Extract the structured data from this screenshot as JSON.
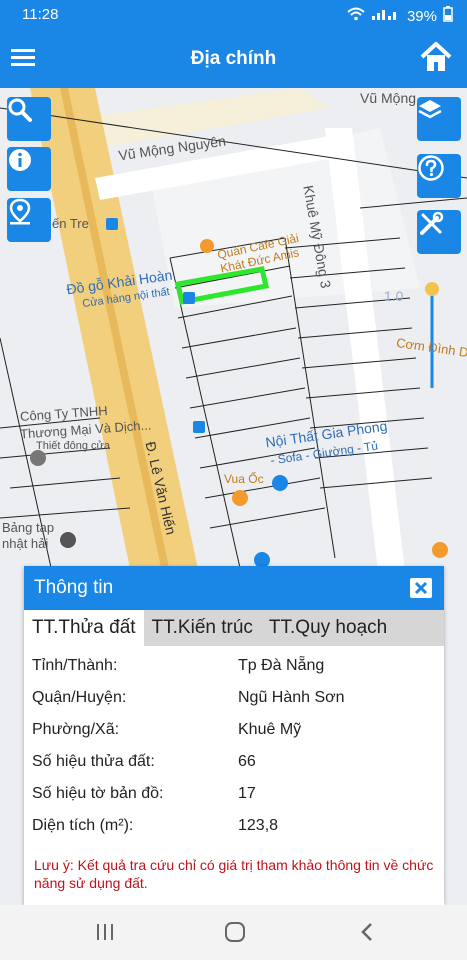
{
  "status_bar": {
    "time": "11:28",
    "battery": "39%"
  },
  "header": {
    "title": "Địa chính"
  },
  "map": {
    "labels": {
      "vu_mong_nguyen": "Vũ Mộng Nguyên",
      "vu_mong_top": "Vũ Mộng",
      "khue_my_dong_3": "Khuê Mỹ Đông 3",
      "le_van_hien": "Đ. Lê Văn Hiến",
      "do_go_khai_hoan": "Đồ gỗ Khải Hoàn",
      "cua_hang_noi_that": "Cửa hàng nội thất",
      "quan_cafe": "Quán Cafe Giải Khát Đức Amis",
      "cong_ty": "Công Ty TNHH",
      "thuong_mai": "Thương Mại Và Dịch...",
      "thiet_dong_cua": "Thiết đông cửa",
      "noi_that_gia_phong": "Nội Thất Gia Phong",
      "sofa": "- Sofa - Giường - Tủ",
      "vua_oc": "Vua Ốc",
      "bang_tap": "Bảng tạp",
      "nhat_hai": "nhật hải",
      "com_dinh": "Cơm Đình D",
      "ien_tre": "ến Tre",
      "scale": "1.0"
    },
    "accent_color": "#1a86e6",
    "highlight_color": "#2ee62e"
  },
  "panel": {
    "title": "Thông tin",
    "tabs": [
      "TT.Thửa đất",
      "TT.Kiến trúc",
      "TT.Quy hoạch"
    ],
    "rows": [
      {
        "key": "Tỉnh/Thành:",
        "value": "Tp Đà Nẵng"
      },
      {
        "key": "Quận/Huyện:",
        "value": "Ngũ Hành Sơn"
      },
      {
        "key": "Phường/Xã:",
        "value": "Khuê Mỹ"
      },
      {
        "key": "Số hiệu thửa đất:",
        "value": "66"
      },
      {
        "key": "Số hiệu tờ bản đồ:",
        "value": "17"
      },
      {
        "key": "Diện tích (m²):",
        "value": "123,8"
      }
    ],
    "note": "Lưu ý: Kết quả tra cứu chỉ có giá trị tham khảo thông tin về chức năng sử dụng đất."
  }
}
